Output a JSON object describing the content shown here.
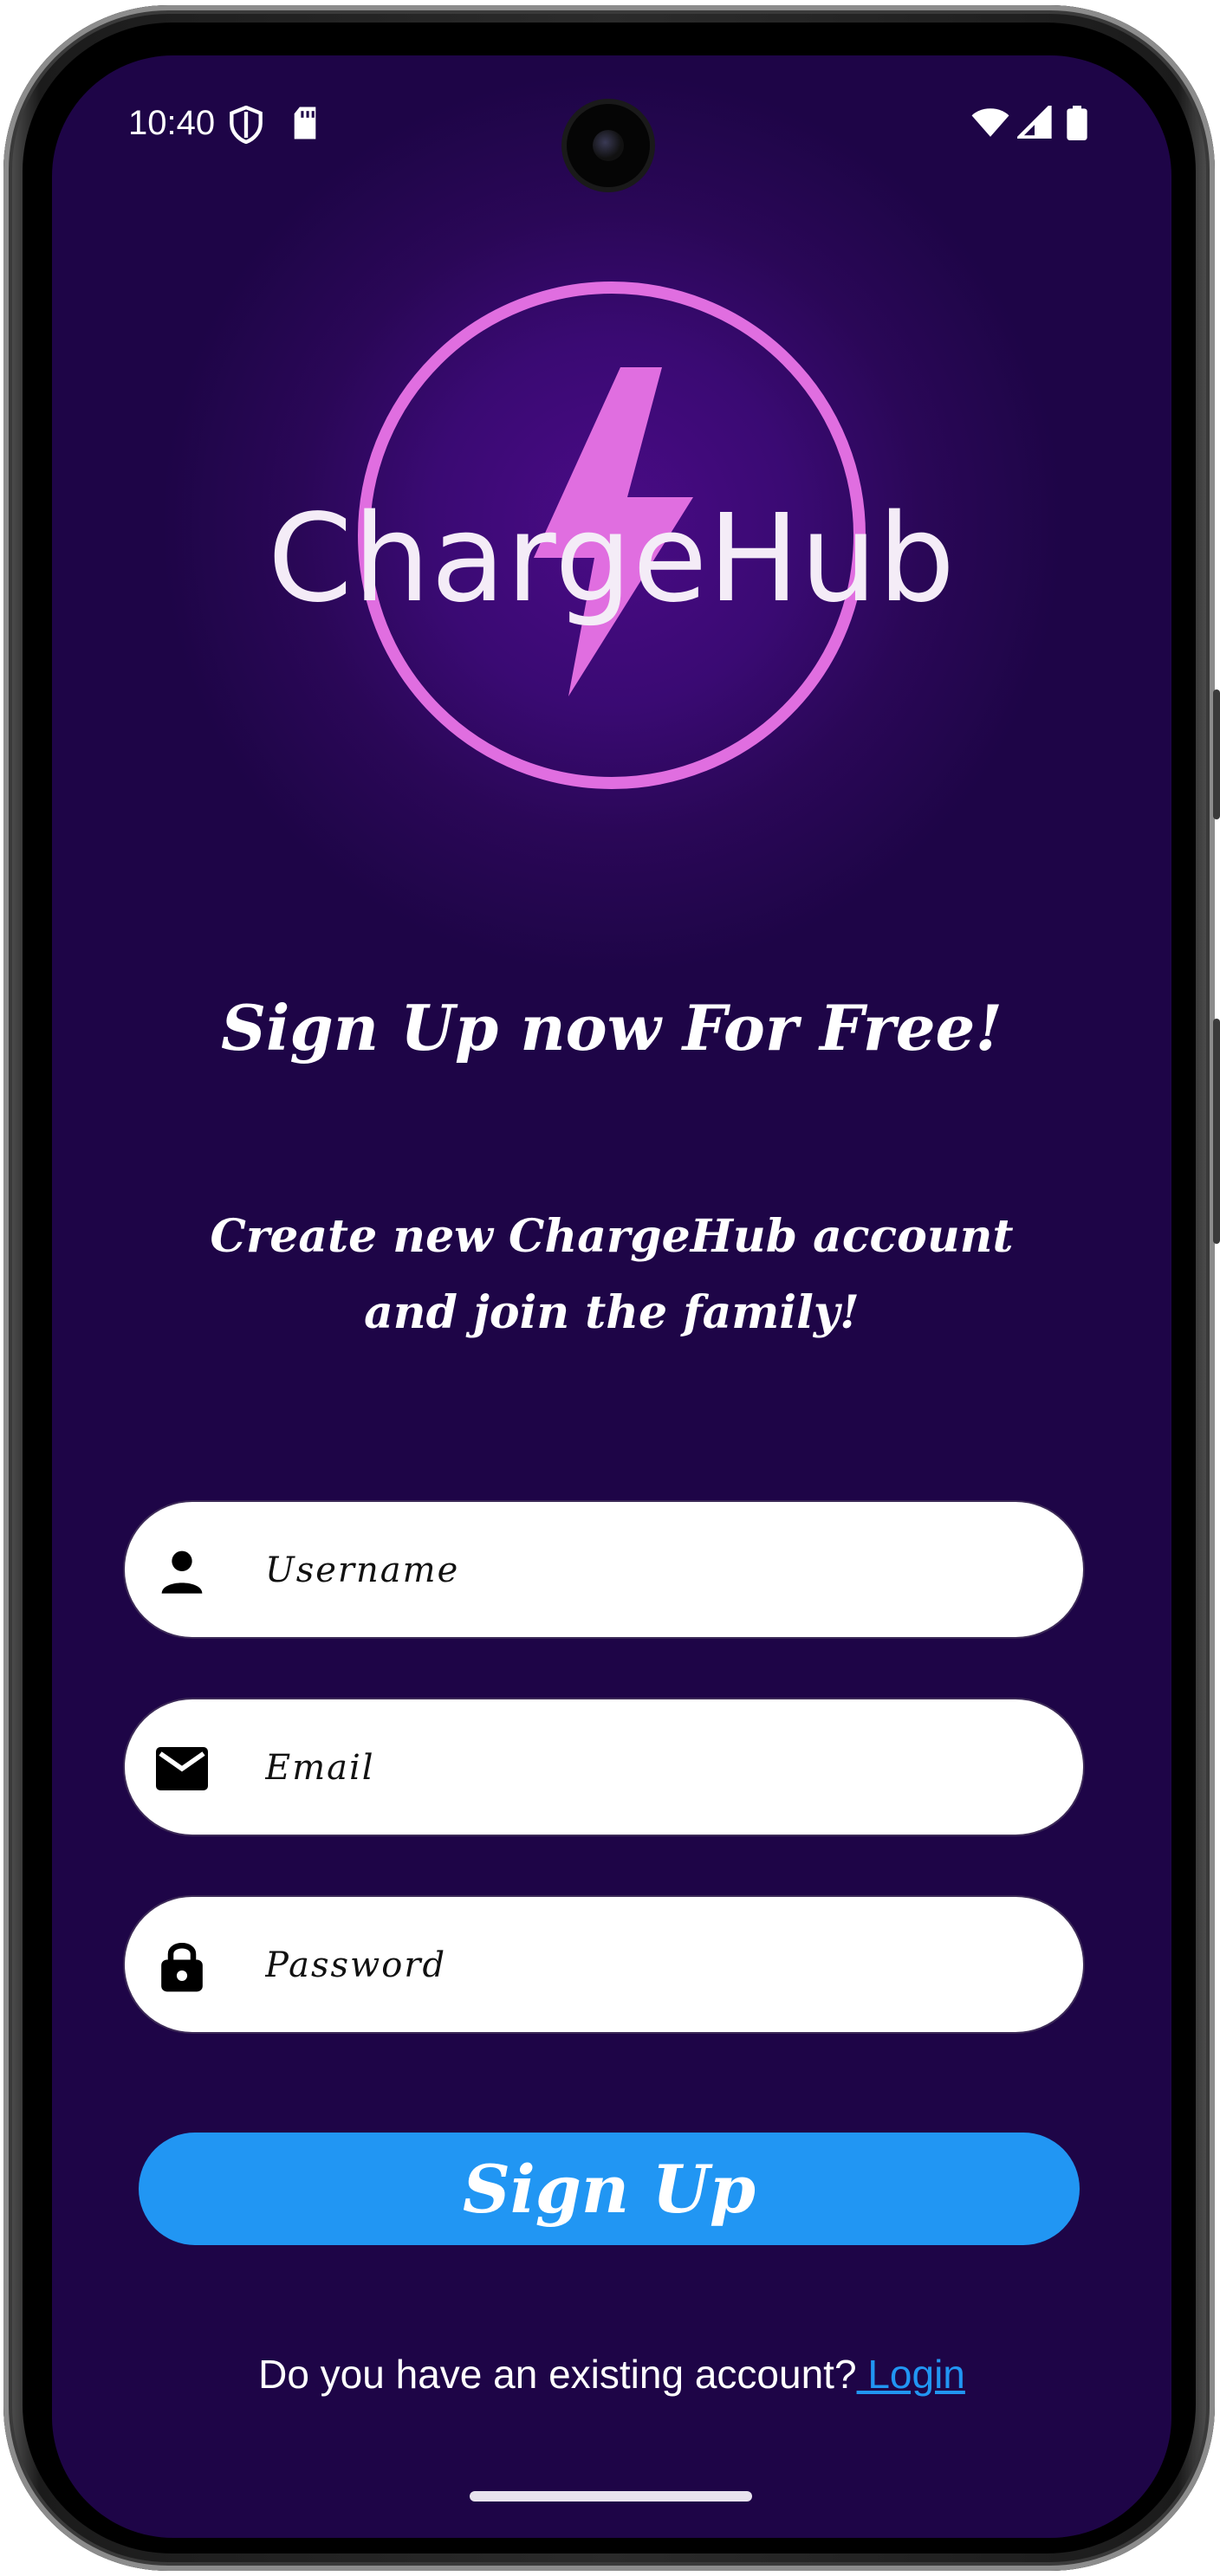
{
  "status_bar": {
    "time": "10:40",
    "left_icons": [
      "shield-icon",
      "sd-card-icon"
    ],
    "right_icons": [
      "wifi-icon",
      "cell-signal-icon",
      "battery-icon"
    ]
  },
  "logo": {
    "text": "ChargeHub",
    "ring_color": "#e06ee0",
    "bolt_color": "#e06ee0"
  },
  "heading": "Sign Up now For Free!",
  "subheading": {
    "line1": "Create new ChargeHub account",
    "line2": "and join the family!"
  },
  "form": {
    "username": {
      "placeholder": "Username",
      "value": "",
      "icon": "person-icon"
    },
    "email": {
      "placeholder": "Email",
      "value": "",
      "icon": "mail-icon"
    },
    "password": {
      "placeholder": "Password",
      "value": "",
      "icon": "lock-icon"
    }
  },
  "signup_button": {
    "label": "Sign Up"
  },
  "login_prompt": {
    "text": "Do you have an existing account?",
    "link": " Login"
  },
  "colors": {
    "background": "#1e0547",
    "accent_blue": "#2196f3",
    "logo_pink": "#e06ee0"
  }
}
